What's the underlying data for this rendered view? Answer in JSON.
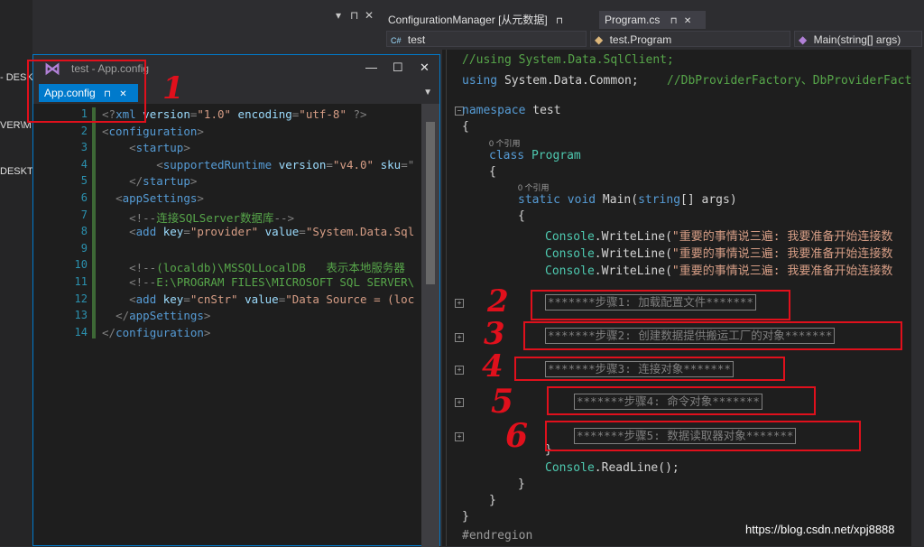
{
  "left_panel": {
    "items": [
      "- DESK",
      "VER\\M",
      "DESKT"
    ]
  },
  "toolbar_icons": [
    "▾",
    "⊓",
    "✕"
  ],
  "float_window": {
    "title": "test - App.config",
    "tab_label": "App.config",
    "pin_icon": "⊓",
    "close_icon": "✕",
    "min_icon": "—",
    "max_icon": "☐",
    "dd_icon": "▼",
    "line_numbers": [
      "1",
      "2",
      "3",
      "4",
      "5",
      "6",
      "7",
      "8",
      "9",
      "10",
      "11",
      "12",
      "13",
      "14"
    ],
    "lines": [
      [
        [
          "b",
          "<?"
        ],
        [
          "t",
          "xml"
        ],
        [
          "a",
          " version"
        ],
        [
          "b",
          "="
        ],
        [
          "v",
          "\"1.0\""
        ],
        [
          "a",
          " encoding"
        ],
        [
          "b",
          "="
        ],
        [
          "v",
          "\"utf-8\""
        ],
        [
          "b",
          " ?>"
        ]
      ],
      [
        [
          "b",
          "<"
        ],
        [
          "t",
          "configuration"
        ],
        [
          "b",
          ">"
        ]
      ],
      [
        [
          "x",
          "    "
        ],
        [
          "b",
          "<"
        ],
        [
          "t",
          "startup"
        ],
        [
          "b",
          ">"
        ]
      ],
      [
        [
          "x",
          "        "
        ],
        [
          "b",
          "<"
        ],
        [
          "t",
          "supportedRuntime"
        ],
        [
          "a",
          " version"
        ],
        [
          "b",
          "="
        ],
        [
          "v",
          "\"v4.0\""
        ],
        [
          "a",
          " sku"
        ],
        [
          "b",
          "=\""
        ]
      ],
      [
        [
          "x",
          "    "
        ],
        [
          "b",
          "</"
        ],
        [
          "t",
          "startup"
        ],
        [
          "b",
          ">"
        ]
      ],
      [
        [
          "x",
          "  "
        ],
        [
          "b",
          "<"
        ],
        [
          "t",
          "appSettings"
        ],
        [
          "b",
          ">"
        ]
      ],
      [
        [
          "x",
          "    "
        ],
        [
          "b",
          "<!--"
        ],
        [
          "c",
          "连接SQLServer数据库"
        ],
        [
          "b",
          "-->"
        ]
      ],
      [
        [
          "x",
          "    "
        ],
        [
          "b",
          "<"
        ],
        [
          "t",
          "add"
        ],
        [
          "a",
          " key"
        ],
        [
          "b",
          "="
        ],
        [
          "v",
          "\"provider\""
        ],
        [
          "a",
          " value"
        ],
        [
          "b",
          "="
        ],
        [
          "v",
          "\"System.Data.Sql"
        ]
      ],
      [
        [
          "x",
          ""
        ]
      ],
      [
        [
          "x",
          "    "
        ],
        [
          "b",
          "<!--"
        ],
        [
          "c",
          "(localdb)\\MSSQLLocalDB   表示本地服务器"
        ]
      ],
      [
        [
          "x",
          "    "
        ],
        [
          "b",
          "<!--"
        ],
        [
          "c",
          "E:\\PROGRAM FILES\\MICROSOFT SQL SERVER\\"
        ]
      ],
      [
        [
          "x",
          "    "
        ],
        [
          "b",
          "<"
        ],
        [
          "t",
          "add"
        ],
        [
          "a",
          " key"
        ],
        [
          "b",
          "="
        ],
        [
          "v",
          "\"cnStr\""
        ],
        [
          "a",
          " value"
        ],
        [
          "b",
          "="
        ],
        [
          "v",
          "\"Data Source = (loc"
        ]
      ],
      [
        [
          "x",
          "  "
        ],
        [
          "b",
          "</"
        ],
        [
          "t",
          "appSettings"
        ],
        [
          "b",
          ">"
        ]
      ],
      [
        [
          "b",
          "</"
        ],
        [
          "t",
          "configuration"
        ],
        [
          "b",
          ">"
        ]
      ]
    ]
  },
  "right_tabs": {
    "tab1": "ConfigurationManager [从元数据]",
    "tab1_pin": "⊓",
    "tab2": "Program.cs",
    "tab2_pin": "⊓",
    "tab2_close": "✕"
  },
  "nav_bar": {
    "project": "test",
    "class": "test.Program",
    "member": "Main(string[] args)"
  },
  "code": {
    "using1": "//using System.Data.SqlClient;",
    "using2_kw": "using",
    "using2_ns": " System.Data.Common;",
    "using2_cm": "//DbProviderFactory、DbProviderFactori",
    "ns_kw": "namespace",
    "ns_name": " test",
    "brace_open": "{",
    "brace_close": "}",
    "refs": "0 个引用",
    "class_kw": "class",
    "class_name": " Program",
    "static_kw": "static",
    "void_kw": " void",
    "main_sig": " Main(",
    "string_kw": "string",
    "main_args": "[] args)",
    "console": "Console",
    "writeline": ".WriteLine(",
    "wl_str": "\"重要的事情说三遍: 我要准备开始连接数",
    "readline": ".ReadLine();",
    "endregion": "#endregion",
    "regions": [
      "*******步骤1: 加载配置文件*******",
      "*******步骤2: 创建数据提供搬运工厂的对象*******",
      "*******步骤3: 连接对象*******",
      "*******步骤4: 命令对象*******",
      "*******步骤5: 数据读取器对象*******"
    ]
  },
  "annotations": [
    "1",
    "2",
    "3",
    "4",
    "5",
    "6"
  ],
  "watermark": "https://blog.csdn.net/xpj8888",
  "colors": {
    "accent": "#007acc",
    "annotation_red": "#e0101c"
  }
}
